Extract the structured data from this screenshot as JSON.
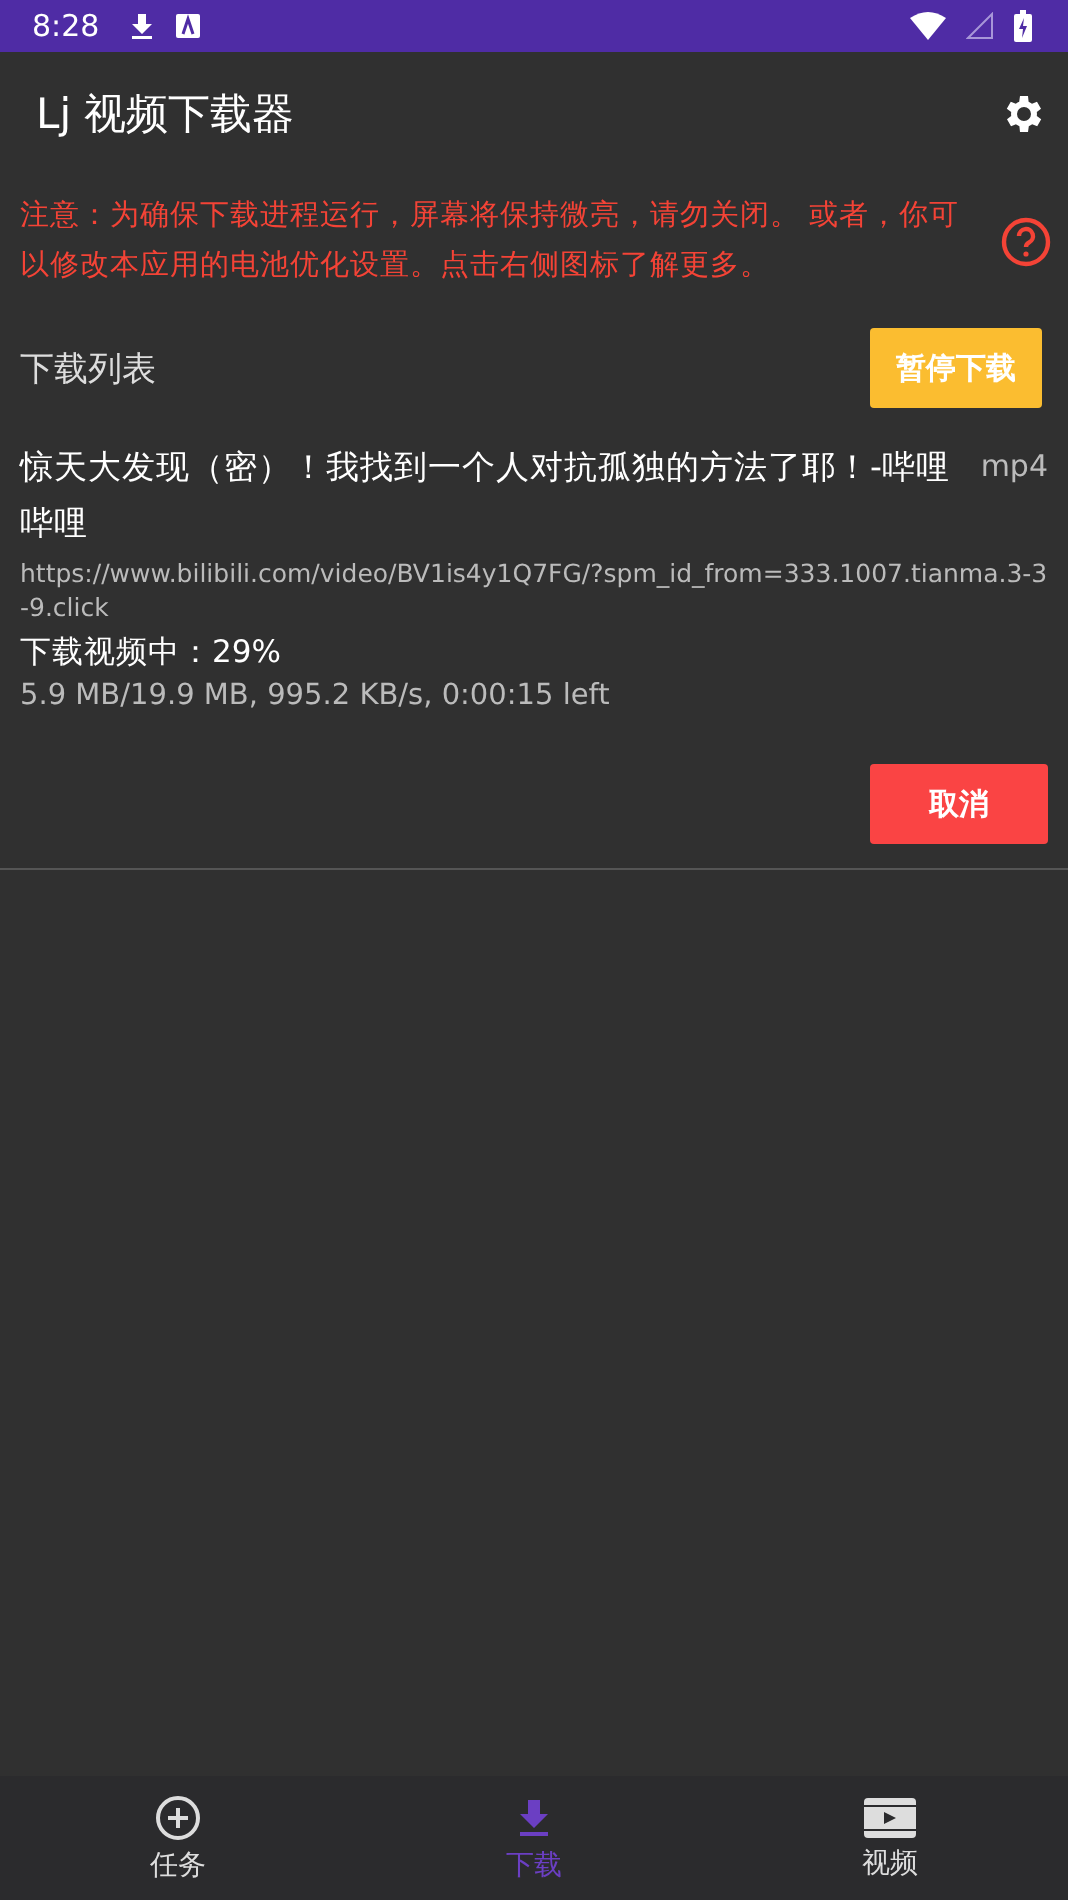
{
  "status_bar": {
    "time": "8:28"
  },
  "app_bar": {
    "title": "Lj 视频下载器"
  },
  "notice": {
    "text": "注意：为确保下载进程运行，屏幕将保持微亮，请勿关闭。 或者，你可以修改本应用的电池优化设置。点击右侧图标了解更多。"
  },
  "list_header": {
    "title": "下载列表",
    "button": "暂停下载"
  },
  "downloads": [
    {
      "title": "惊天大发现（密）！我找到一个人对抗孤独的方法了耶！-哔哩哔哩",
      "format": "mp4",
      "url": "https://www.bilibili.com/video/BV1is4y1Q7FG/?spm_id_from=333.1007.tianma.3-3-9.click",
      "status": "下载视频中：29%",
      "progress": "5.9 MB/19.9 MB, 995.2 KB/s, 0:00:15 left",
      "button": "取消"
    }
  ],
  "bottom_nav": [
    {
      "label": "任务",
      "kind": "add",
      "selected": false
    },
    {
      "label": "下载",
      "kind": "download",
      "selected": true
    },
    {
      "label": "视频",
      "kind": "film",
      "selected": false
    }
  ]
}
